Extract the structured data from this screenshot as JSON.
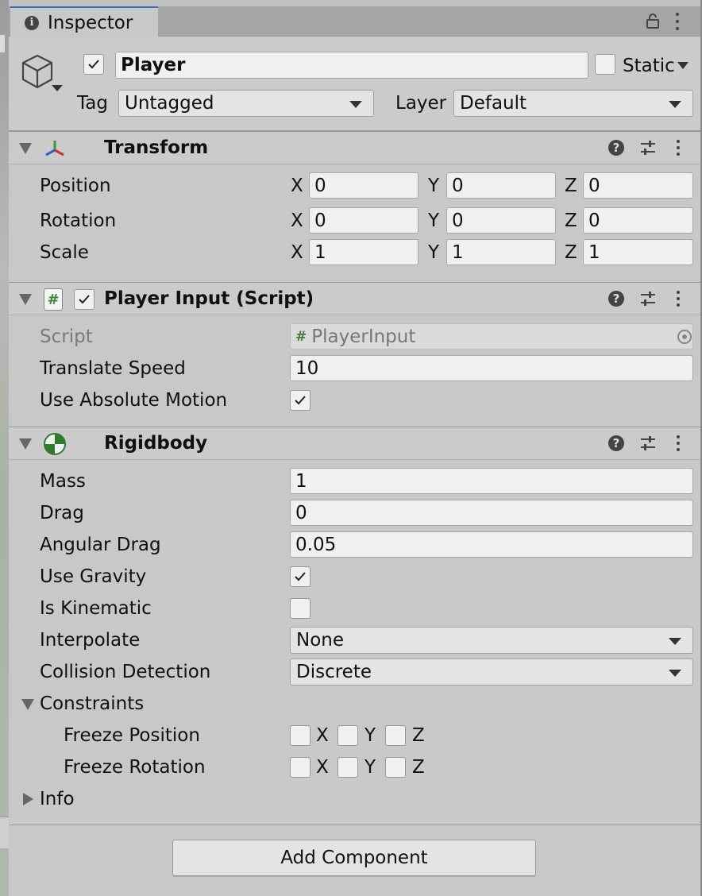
{
  "tab": {
    "title": "Inspector"
  },
  "gameobject": {
    "active": true,
    "name": "Player",
    "static_label": "Static",
    "static_checked": false,
    "tag_label": "Tag",
    "tag_value": "Untagged",
    "layer_label": "Layer",
    "layer_value": "Default"
  },
  "transform": {
    "title": "Transform",
    "rows": [
      {
        "label": "Position",
        "x": "0",
        "y": "0",
        "z": "0"
      },
      {
        "label": "Rotation",
        "x": "0",
        "y": "0",
        "z": "0"
      },
      {
        "label": "Scale",
        "x": "1",
        "y": "1",
        "z": "1"
      }
    ],
    "axis": {
      "x": "X",
      "y": "Y",
      "z": "Z"
    }
  },
  "player_input": {
    "title": "Player Input (Script)",
    "enabled": true,
    "script_label": "Script",
    "script_value": "PlayerInput",
    "translate_speed_label": "Translate Speed",
    "translate_speed_value": "10",
    "use_absolute_motion_label": "Use Absolute Motion",
    "use_absolute_motion": true
  },
  "rigidbody": {
    "title": "Rigidbody",
    "mass_label": "Mass",
    "mass": "1",
    "drag_label": "Drag",
    "drag": "0",
    "angular_drag_label": "Angular Drag",
    "angular_drag": "0.05",
    "use_gravity_label": "Use Gravity",
    "use_gravity": true,
    "is_kinematic_label": "Is Kinematic",
    "is_kinematic": false,
    "interpolate_label": "Interpolate",
    "interpolate": "None",
    "collision_label": "Collision Detection",
    "collision": "Discrete",
    "constraints_label": "Constraints",
    "freeze_position_label": "Freeze Position",
    "freeze_rotation_label": "Freeze Rotation",
    "info_label": "Info"
  },
  "add_component": "Add Component",
  "colors": {
    "tab_accent": "#3a72b0",
    "panel_bg": "#c8c8c8",
    "field_bg": "#f0f0f0"
  }
}
